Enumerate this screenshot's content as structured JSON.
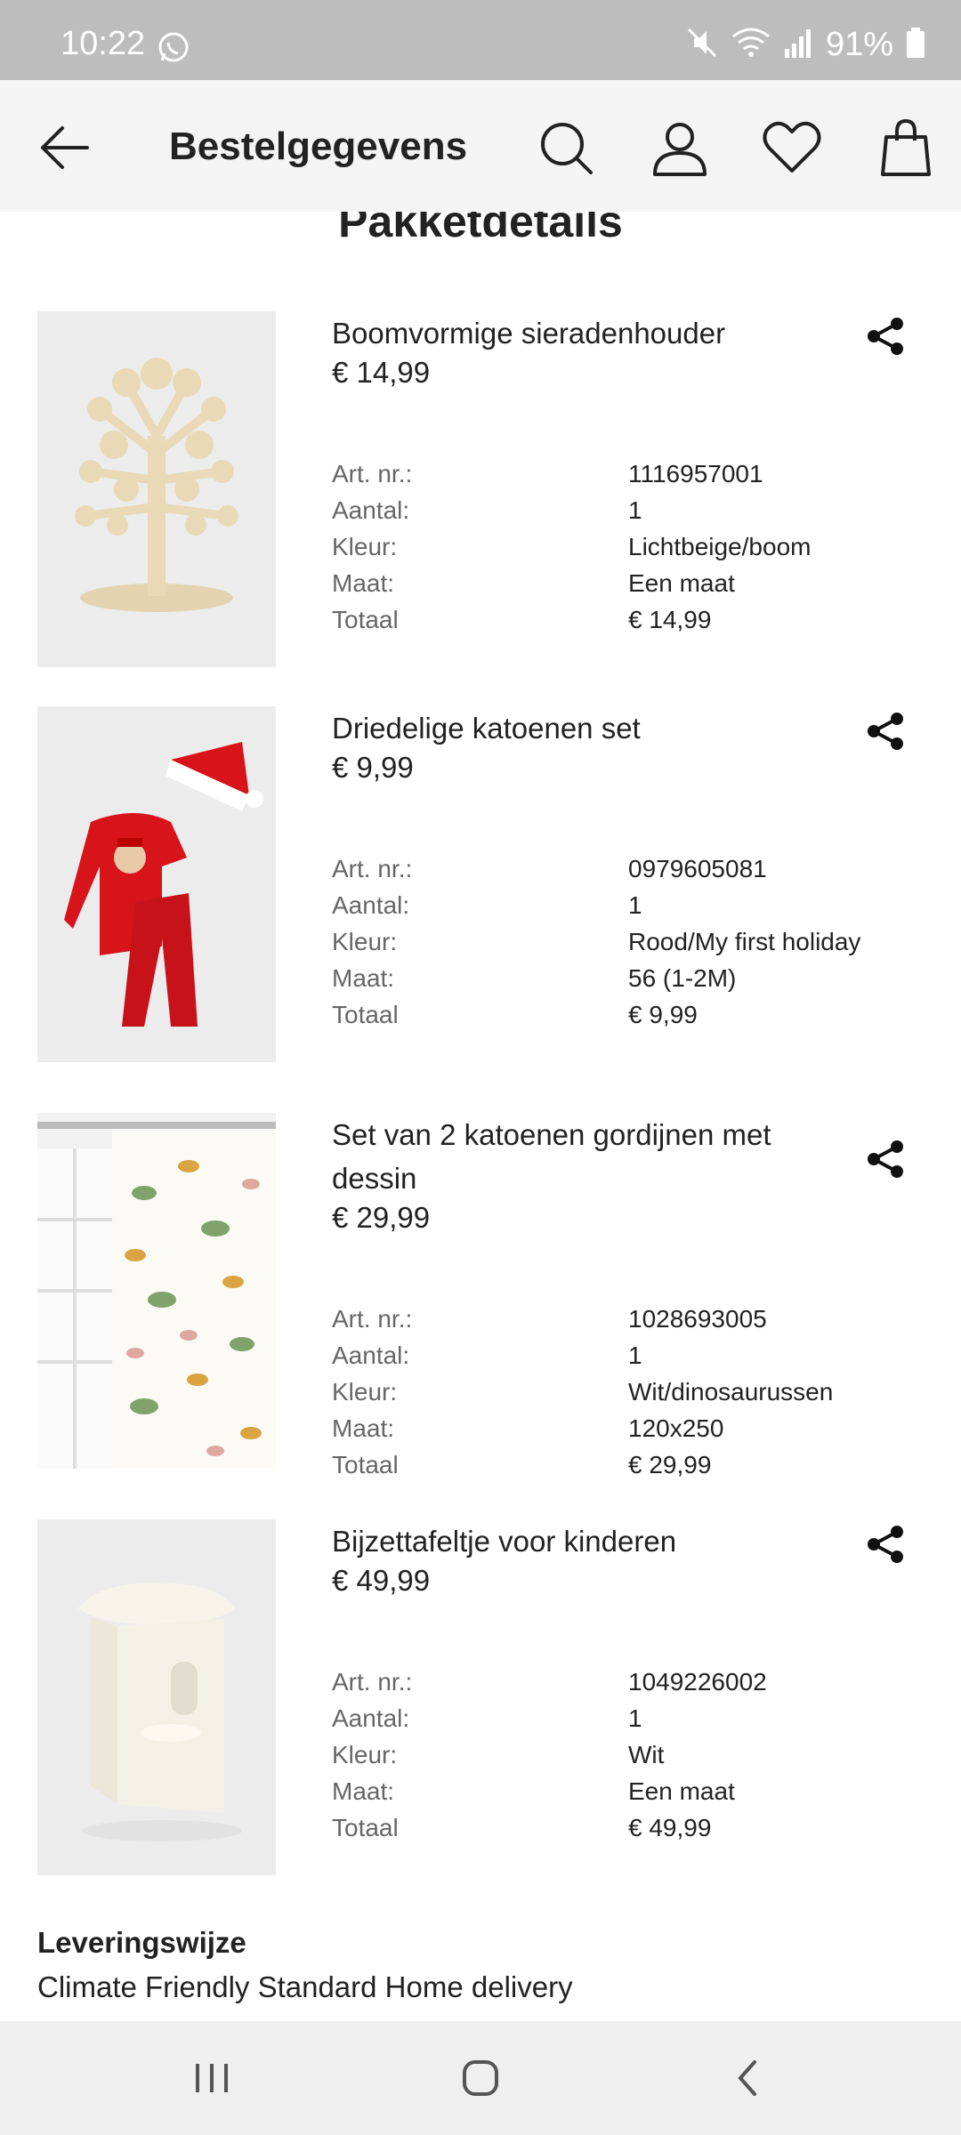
{
  "status_bar": {
    "time": "10:22",
    "battery": "91%"
  },
  "header": {
    "title": "Bestelgegevens"
  },
  "section_title": "Pakketdetails",
  "labels": {
    "art": "Art. nr.:",
    "aantal": "Aantal:",
    "kleur": "Kleur:",
    "maat": "Maat:",
    "totaal": "Totaal"
  },
  "items": [
    {
      "name": "Boomvormige sieradenhouder",
      "price": "€ 14,99",
      "art": "1116957001",
      "aantal": "1",
      "kleur": "Lichtbeige/boom",
      "maat": "Een maat",
      "totaal": "€ 14,99"
    },
    {
      "name": "Driedelige katoenen set",
      "price": "€ 9,99",
      "art": "0979605081",
      "aantal": "1",
      "kleur": "Rood/My first holiday",
      "maat": "56 (1-2M)",
      "totaal": "€ 9,99"
    },
    {
      "name": "Set van 2 katoenen gordijnen met dessin",
      "price": "€ 29,99",
      "art": "1028693005",
      "aantal": "1",
      "kleur": "Wit/dinosaurussen",
      "maat": "120x250",
      "totaal": "€ 29,99"
    },
    {
      "name": "Bijzettafeltje voor kinderen",
      "price": "€ 49,99",
      "art": "1049226002",
      "aantal": "1",
      "kleur": "Wit",
      "maat": "Een maat",
      "totaal": "€ 49,99"
    }
  ],
  "delivery": {
    "label": "Leveringswijze",
    "value": "Climate Friendly Standard Home delivery"
  },
  "icons": {
    "back": "arrow-left-icon",
    "search": "search-icon",
    "account": "user-icon",
    "wishlist": "heart-icon",
    "bag": "shopping-bag-icon",
    "share": "share-icon"
  }
}
